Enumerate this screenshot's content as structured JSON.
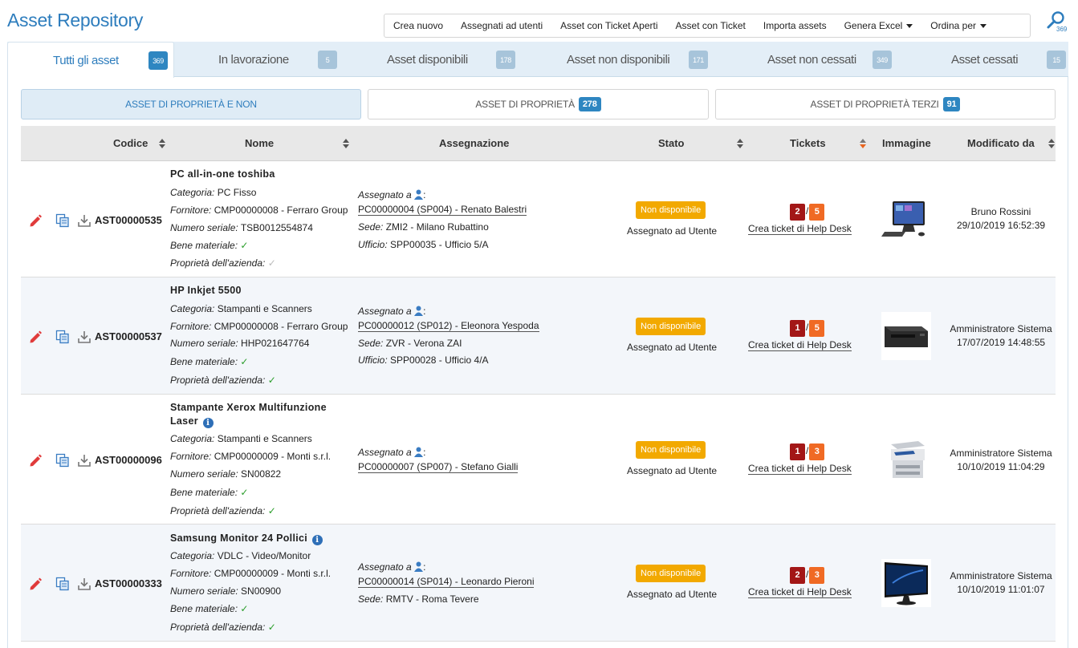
{
  "app": {
    "title": "Asset Repository"
  },
  "toolbar": {
    "new": "Crea nuovo",
    "assigned": "Assegnati ad utenti",
    "open_tickets": "Asset con Ticket Aperti",
    "with_tickets": "Asset con Ticket",
    "import": "Importa assets",
    "excel": "Genera Excel",
    "order": "Ordina per"
  },
  "search": {
    "count": "369"
  },
  "tabs": [
    {
      "label": "Tutti gli asset",
      "count": "369"
    },
    {
      "label": "In lavorazione",
      "count": "5"
    },
    {
      "label": "Asset disponibili",
      "count": "178"
    },
    {
      "label": "Asset non disponibili",
      "count": "171"
    },
    {
      "label": "Asset non cessati",
      "count": "349"
    },
    {
      "label": "Asset cessati",
      "count": "15"
    }
  ],
  "filters": {
    "all": "ASSET DI PROPRIETÀ E NON",
    "owned": "ASSET DI PROPRIETÀ",
    "owned_count": "278",
    "third": "ASSET DI PROPRIETÀ TERZI",
    "third_count": "91"
  },
  "columns": {
    "code": "Codice",
    "name": "Nome",
    "assignment": "Assegnazione",
    "status": "Stato",
    "tickets": "Tickets",
    "image": "Immagine",
    "modified": "Modificato da"
  },
  "labels": {
    "category": "Categoria:",
    "supplier": "Fornitore:",
    "serial": "Numero seriale:",
    "material": "Bene materiale:",
    "property": "Proprietà dell'azienda:",
    "assigned_to": "Assegnato a",
    "site": "Sede:",
    "office": "Ufficio:",
    "create_ticket": "Crea ticket di Help Desk",
    "check": "✓",
    "colon": ":",
    "slash": "/"
  },
  "rows": [
    {
      "code": "AST00000535",
      "name": "PC all-in-one toshiba",
      "category": "PC Fisso",
      "supplier": "CMP00000008 - Ferraro Group",
      "serial": "TSB0012554874",
      "assignee": "PC00000004 (SP004) - Renato Balestri",
      "site": "ZMI2 - Milano Rubattino",
      "office": "SPP00035 - Ufficio 5/A",
      "status_badge": "Non disponibile",
      "status_text": "Assegnato ad Utente",
      "tickets_open": "2",
      "tickets_total": "5",
      "image": "all-in-one-pc",
      "modified_by": "Bruno Rossini",
      "modified_at": "29/10/2019 16:52:39"
    },
    {
      "code": "AST00000537",
      "name": "HP Inkjet 5500",
      "category": "Stampanti e Scanners",
      "supplier": "CMP00000008 - Ferraro Group",
      "serial": "HHP021647764",
      "assignee": "PC00000012 (SP012) - Eleonora Yespoda",
      "site": "ZVR - Verona ZAI",
      "office": "SPP00028 - Ufficio 4/A",
      "status_badge": "Non disponibile",
      "status_text": "Assegnato ad Utente",
      "tickets_open": "1",
      "tickets_total": "5",
      "image": "inkjet-printer",
      "modified_by": "Amministratore Sistema",
      "modified_at": "17/07/2019 14:48:55"
    },
    {
      "code": "AST00000096",
      "name_line1": "Stampante Xerox Multifunzione",
      "name_line2": "Laser",
      "category": "Stampanti e Scanners",
      "supplier": "CMP00000009 - Monti s.r.l.",
      "serial": "SN00822",
      "assignee": "PC00000007 (SP007) - Stefano Gialli",
      "status_badge": "Non disponibile",
      "status_text": "Assegnato ad Utente",
      "tickets_open": "1",
      "tickets_total": "3",
      "image": "multifunction-printer",
      "modified_by": "Amministratore Sistema",
      "modified_at": "10/10/2019 11:04:29"
    },
    {
      "code": "AST00000333",
      "name": "Samsung Monitor 24 Pollici",
      "category": "VDLC - Video/Monitor",
      "supplier": "CMP00000009 - Monti s.r.l.",
      "serial": "SN00900",
      "assignee": "PC00000014 (SP014) - Leonardo Pieroni",
      "site": "RMTV - Roma Tevere",
      "status_badge": "Non disponibile",
      "status_text": "Assegnato ad Utente",
      "tickets_open": "2",
      "tickets_total": "3",
      "image": "monitor",
      "modified_by": "Amministratore Sistema",
      "modified_at": "10/10/2019 11:01:07"
    }
  ],
  "colors": {
    "accent": "#2e7dbd",
    "status": "#f2a900",
    "ticket_open": "#a31717",
    "ticket_total": "#f06a24"
  }
}
